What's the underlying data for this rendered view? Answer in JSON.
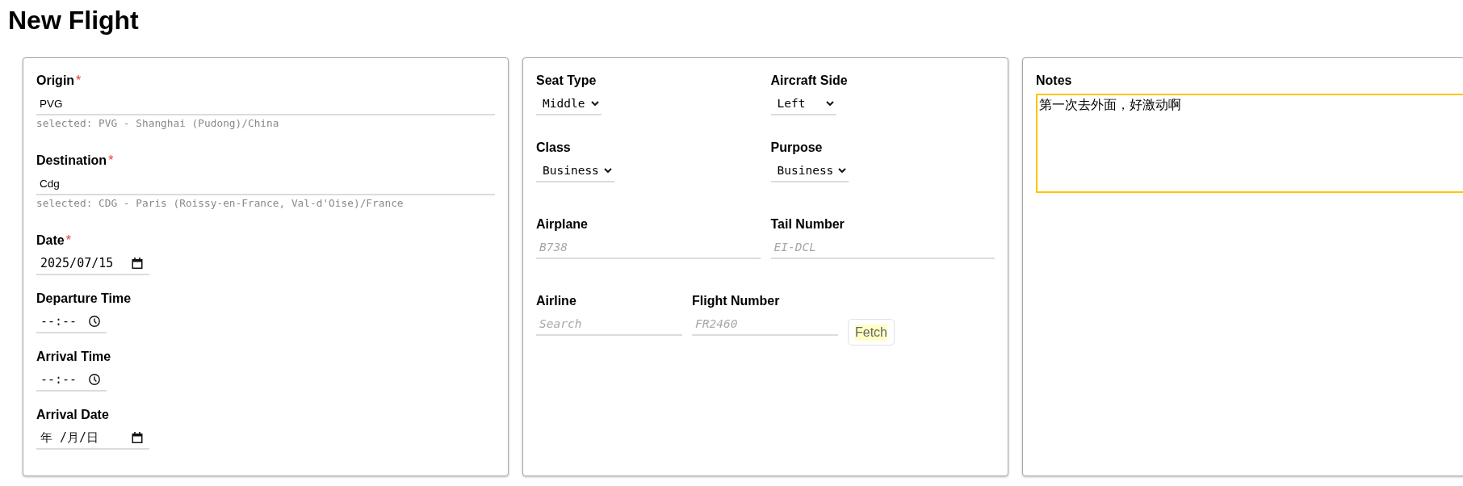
{
  "page": {
    "title": "New Flight"
  },
  "panels": [
    {
      "fields": [
        {
          "kind": "text",
          "label": "Origin",
          "required_mark": "*",
          "value": "PVG",
          "hint": "selected: PVG - Shanghai (Pudong)/China"
        },
        {
          "kind": "text",
          "label": "Destination",
          "required_mark": "*",
          "value": "Cdg",
          "hint": "selected: CDG - Paris (Roissy-en-France, Val-d'Oise)/France"
        },
        {
          "kind": "date",
          "label": "Date",
          "required_mark": "*",
          "value": "2025/07/15"
        },
        {
          "kind": "time",
          "label": "Departure Time",
          "placeholder": "--:--"
        },
        {
          "kind": "time",
          "label": "Arrival Time",
          "placeholder": "--:--"
        },
        {
          "kind": "date",
          "label": "Arrival Date",
          "placeholder": "年 /月/日"
        }
      ]
    },
    {
      "rows": [
        {
          "kind": "pair",
          "fields": [
            {
              "kind": "select",
              "label": "Seat Type",
              "value": "Middle"
            },
            {
              "kind": "select",
              "label": "Aircraft Side",
              "value": "Left"
            }
          ]
        },
        {
          "kind": "pair",
          "fields": [
            {
              "kind": "select",
              "label": "Class",
              "value": "Business"
            },
            {
              "kind": "select",
              "label": "Purpose",
              "value": "Business"
            }
          ]
        },
        {
          "kind": "pair",
          "fields": [
            {
              "kind": "text",
              "label": "Airplane",
              "placeholder": "B738"
            },
            {
              "kind": "text",
              "label": "Tail Number",
              "placeholder": "EI-DCL"
            }
          ]
        },
        {
          "kind": "inline",
          "fields": [
            {
              "kind": "text",
              "label": "Airline",
              "placeholder": "Search"
            },
            {
              "kind": "text",
              "label": "Flight Number",
              "placeholder": "FR2460"
            },
            {
              "kind": "button",
              "label": "Fetch"
            }
          ]
        }
      ]
    },
    {
      "fields": [
        {
          "kind": "textarea",
          "label": "Notes",
          "value": "第一次去外面，好激动啊",
          "focused": true
        }
      ]
    }
  ]
}
